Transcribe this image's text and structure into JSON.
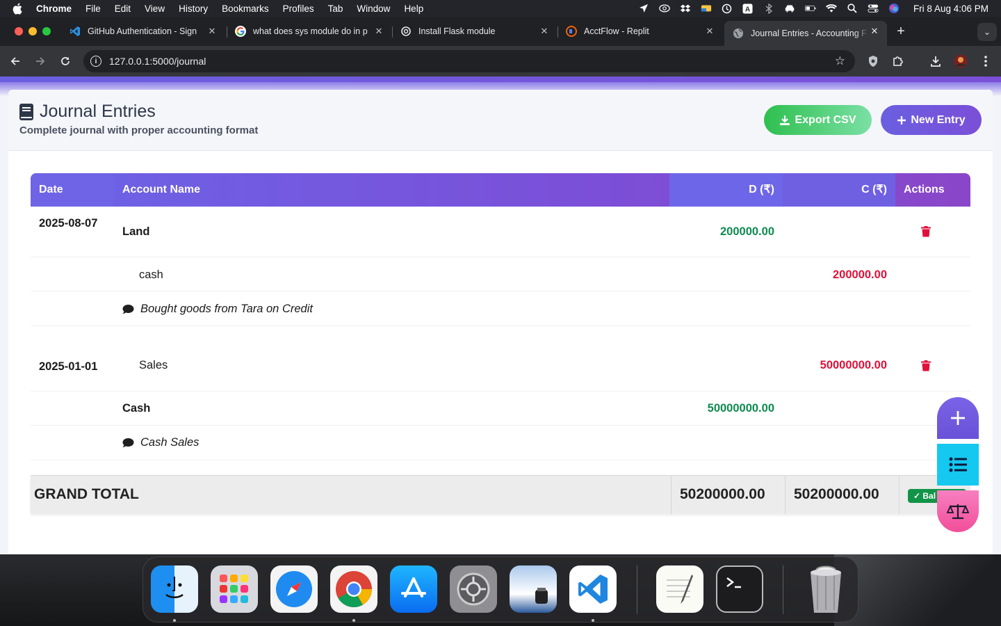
{
  "menubar": {
    "app_name": "Chrome",
    "items": [
      "File",
      "Edit",
      "View",
      "History",
      "Bookmarks",
      "Profiles",
      "Tab",
      "Window",
      "Help"
    ],
    "clock": "Fri 8 Aug  4:06 PM",
    "status_icons": [
      "location-icon",
      "creative-cloud-icon",
      "dropbox-icon",
      "drive-icon",
      "time-machine-icon",
      "keyboard-a-icon",
      "bluetooth-icon",
      "car-icon",
      "battery-icon",
      "wifi-icon",
      "spotlight-icon",
      "control-center-icon",
      "siri-icon"
    ]
  },
  "tabs": [
    {
      "title": "GitHub Authentication - Sign",
      "icon": "vscode-icon"
    },
    {
      "title": "what does sys module do in p",
      "icon": "google-icon"
    },
    {
      "title": "Install Flask module",
      "icon": "openai-icon"
    },
    {
      "title": "AcctFlow - Replit",
      "icon": "replit-icon"
    },
    {
      "title": "Journal Entries - Accounting F",
      "icon": "globe-icon",
      "active": true
    }
  ],
  "address_bar": {
    "url": "127.0.0.1:5000/journal"
  },
  "page": {
    "title": "Journal Entries",
    "subtitle": "Complete journal with proper accounting format",
    "export_label": "Export CSV",
    "new_entry_label": "New Entry"
  },
  "table": {
    "headers": {
      "date": "Date",
      "account": "Account Name",
      "debit": "D (₹)",
      "credit": "C (₹)",
      "actions": "Actions"
    },
    "entries": [
      {
        "date": "2025-08-07",
        "lines": [
          {
            "account": "Land",
            "debit": "200000.00",
            "credit": ""
          },
          {
            "account": "cash",
            "debit": "",
            "credit": "200000.00"
          }
        ],
        "narration": "Bought goods from Tara on Credit"
      },
      {
        "date": "2025-01-01",
        "lines": [
          {
            "account": "Sales",
            "debit": "",
            "credit": "50000000.00"
          },
          {
            "account": "Cash",
            "debit": "50000000.00",
            "credit": ""
          }
        ],
        "narration": "Cash Sales"
      }
    ],
    "grand_total": {
      "label": "GRAND TOTAL",
      "debit": "50200000.00",
      "credit": "50200000.00",
      "status": "✓ Bal"
    }
  },
  "colors": {
    "accent": "#6c63e6",
    "debit": "#0e8a4e",
    "credit": "#e0103a",
    "export": "#2fbf4f"
  },
  "dock": {
    "apps": [
      "finder-icon",
      "launchpad-icon",
      "safari-icon",
      "chrome-icon",
      "app-store-icon",
      "system-settings-icon",
      "preview-icon",
      "vscode-icon",
      "textedit-icon",
      "terminal-icon",
      "trash-icon"
    ]
  }
}
